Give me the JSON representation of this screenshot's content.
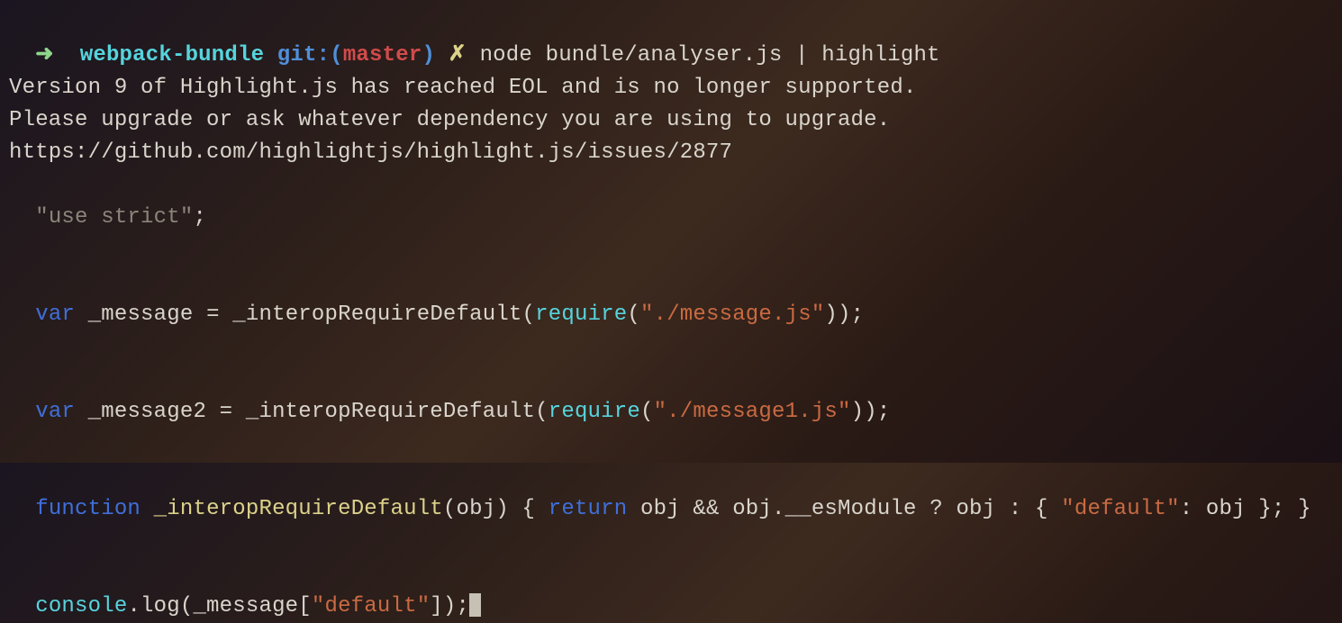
{
  "prompt": {
    "arrow": "➜",
    "dir": "webpack-bundle",
    "git_label": "git:(",
    "branch": "master",
    "git_close": ")",
    "xmark": "✗",
    "command": "node bundle/analyser.js | highlight"
  },
  "warn": {
    "l1": "Version 9 of Highlight.js has reached EOL and is no longer supported.",
    "l2": "Please upgrade or ask whatever dependency you are using to upgrade.",
    "l3": "https://github.com/highlightjs/highlight.js/issues/2877"
  },
  "code": {
    "use_strict": "\"use strict\"",
    "var_kw": "var",
    "msg1_name": "_message",
    "msg2_name": "_message2",
    "interop_call": "_interopRequireDefault",
    "require_kw": "require",
    "msg1_path": "\"./message.js\"",
    "msg2_path": "\"./message1.js\"",
    "func_kw": "function",
    "func_name": "_interopRequireDefault",
    "func_params": "(obj)",
    "return_kw": "return",
    "func_body_a": "obj && obj.__esModule ? obj : { ",
    "default_str": "\"default\"",
    "func_body_b": ": obj }; }",
    "console_obj": "console",
    "log_fn": ".log(_message[",
    "log_key": "\"default\"",
    "log_close": "]);"
  }
}
